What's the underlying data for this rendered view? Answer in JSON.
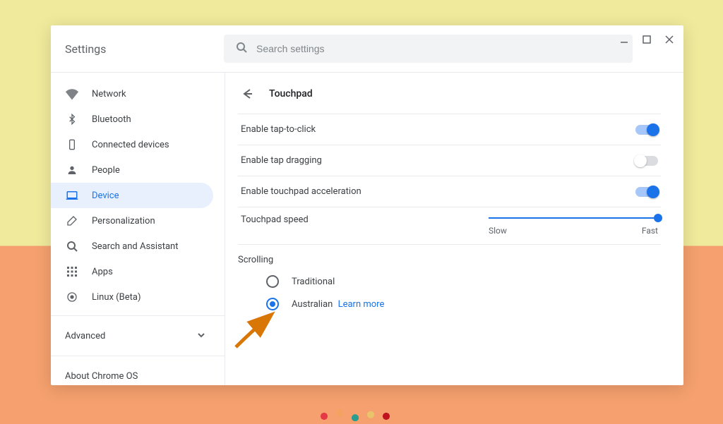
{
  "header": {
    "title": "Settings"
  },
  "search": {
    "placeholder": "Search settings"
  },
  "sidebar": {
    "items": [
      {
        "label": "Network"
      },
      {
        "label": "Bluetooth"
      },
      {
        "label": "Connected devices"
      },
      {
        "label": "People"
      },
      {
        "label": "Device"
      },
      {
        "label": "Personalization"
      },
      {
        "label": "Search and Assistant"
      },
      {
        "label": "Apps"
      },
      {
        "label": "Linux (Beta)"
      }
    ],
    "advanced": "Advanced",
    "about": "About Chrome OS"
  },
  "page": {
    "title": "Touchpad",
    "tap_to_click": "Enable tap-to-click",
    "tap_dragging": "Enable tap dragging",
    "touchpad_accel": "Enable touchpad acceleration",
    "touchpad_speed": "Touchpad speed",
    "slow": "Slow",
    "fast": "Fast",
    "scrolling": "Scrolling",
    "traditional": "Traditional",
    "australian": "Australian",
    "learn_more": "Learn more"
  },
  "toggles": {
    "tap_to_click": true,
    "tap_dragging": false,
    "touchpad_accel": true
  }
}
